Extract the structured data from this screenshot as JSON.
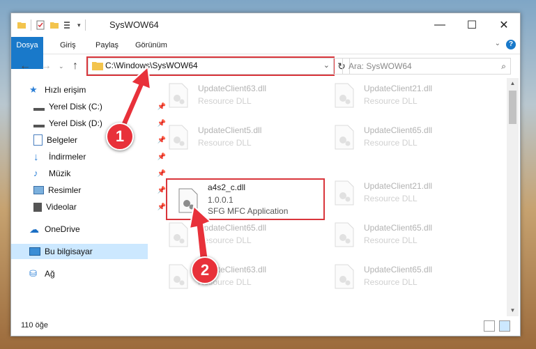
{
  "window": {
    "title": "SysWOW64"
  },
  "ribbon": {
    "tabs": [
      "Dosya",
      "Giriş",
      "Paylaş",
      "Görünüm"
    ]
  },
  "address": {
    "path": "C:\\Windows\\SysWOW64"
  },
  "search": {
    "placeholder": "Ara: SysWOW64"
  },
  "nav": {
    "items": [
      {
        "label": "Hızlı erişim"
      },
      {
        "label": "Yerel Disk (C:)"
      },
      {
        "label": "Yerel Disk (D:)"
      },
      {
        "label": "Belgeler"
      },
      {
        "label": "İndirmeler"
      },
      {
        "label": "Müzik"
      },
      {
        "label": "Resimler"
      },
      {
        "label": "Videolar"
      },
      {
        "label": "OneDrive"
      },
      {
        "label": "Bu bilgisayar"
      },
      {
        "label": "Ağ"
      }
    ]
  },
  "files": [
    {
      "name": "UpdateClient63.dll",
      "desc": "Resource DLL"
    },
    {
      "name": "UpdateClient21.dll",
      "desc": "Resource DLL"
    },
    {
      "name": "UpdateClient5.dll",
      "desc": "Resource DLL"
    },
    {
      "name": "UpdateClient65.dll",
      "desc": "Resource DLL"
    },
    {
      "name": "a4s2_c.dll",
      "version": "1.0.0.1",
      "desc": "SFG MFC Application"
    },
    {
      "name": "UpdateClient21.dll",
      "desc": "Resource DLL"
    },
    {
      "name": "UpdateClient65.dll",
      "desc": "Resource DLL"
    },
    {
      "name": "UpdateClient65.dll",
      "desc": "Resource DLL"
    },
    {
      "name": "UpdateClient63.dll",
      "desc": "Resource DLL"
    },
    {
      "name": "UpdateClient65.dll",
      "desc": "Resource DLL"
    }
  ],
  "status": {
    "count": "110 öğe"
  },
  "annotations": {
    "step1": "1",
    "step2": "2"
  },
  "colors": {
    "accent": "#1979ca",
    "highlight": "#d9353b",
    "badge": "#e8313a"
  }
}
